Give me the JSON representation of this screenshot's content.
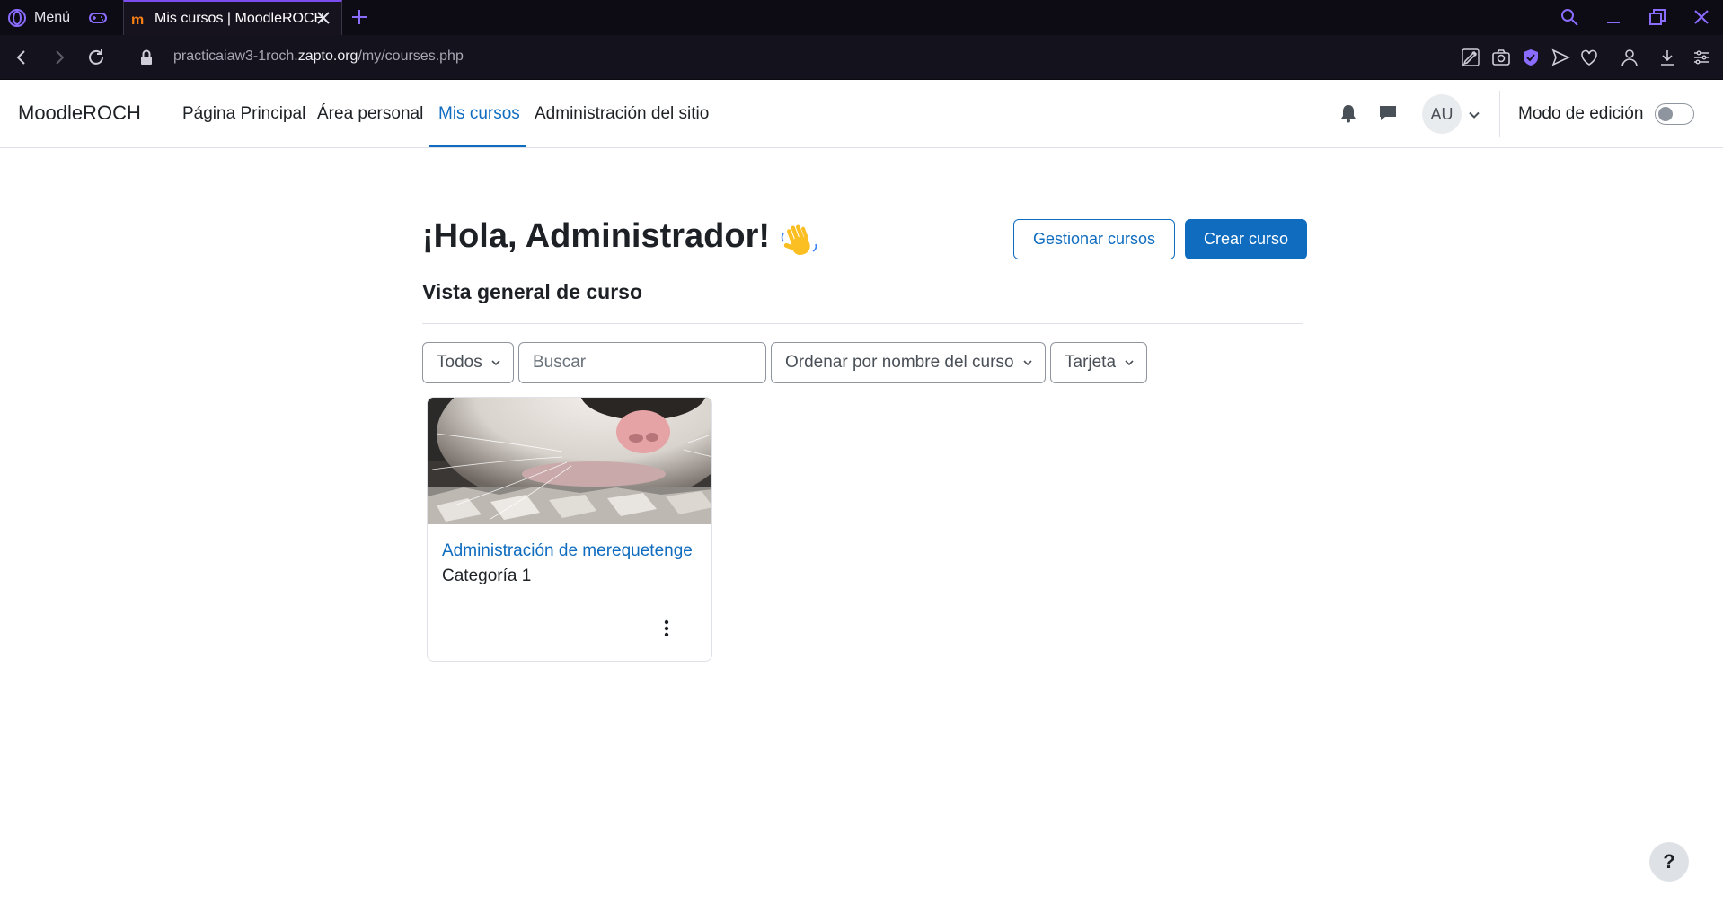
{
  "browser": {
    "menu_label": "Menú",
    "tab_title": "Mis cursos | MoodleROCH",
    "url_prefix": "practicaiaw3-1roch.",
    "url_domain": "zapto.org",
    "url_path": "/my/courses.php"
  },
  "navbar": {
    "brand": "MoodleROCH",
    "links": [
      "Página Principal",
      "Área personal",
      "Mis cursos",
      "Administración del sitio"
    ],
    "active_link": "Mis cursos",
    "avatar_initials": "AU",
    "edit_mode_label": "Modo de edición",
    "edit_mode_on": false
  },
  "header": {
    "greeting": "¡Hola, Administrador!",
    "manage_button": "Gestionar cursos",
    "create_button": "Crear curso"
  },
  "section_title": "Vista general de curso",
  "filters": {
    "grouping": "Todos",
    "search_placeholder": "Buscar",
    "sort": "Ordenar por nombre del curso",
    "view": "Tarjeta"
  },
  "courses": [
    {
      "name": "Administración de merequetenge",
      "category": "Categoría 1"
    }
  ],
  "help_label": "?",
  "colors": {
    "primary": "#0f6cbf",
    "browser_accent": "#7b4df0",
    "text": "#1d2125"
  },
  "icons": [
    "opera-icon",
    "gamepad-icon",
    "moodle-favicon",
    "close-icon",
    "plus-icon",
    "search-icon",
    "minimize-icon",
    "restore-icon",
    "back-icon",
    "forward-icon",
    "reload-icon",
    "lock-icon",
    "snapshot-icon",
    "camera-icon",
    "vpn-shield-icon",
    "send-icon",
    "heart-icon",
    "account-icon",
    "download-icon",
    "settings-icon",
    "bell-icon",
    "chat-icon",
    "chevron-down-icon",
    "wave-icon",
    "kebab-menu-icon"
  ]
}
